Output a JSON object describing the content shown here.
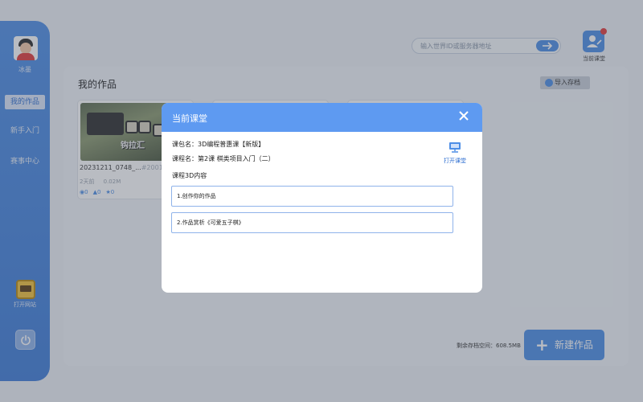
{
  "sidebar": {
    "username": "冰墨",
    "items": [
      {
        "label": "我的作品",
        "active": true
      },
      {
        "label": "新手入门",
        "active": false
      },
      {
        "label": "赛事中心",
        "active": false
      }
    ],
    "open_site_label": "打开网站"
  },
  "topbar": {
    "server_placeholder": "输入世界ID或服务器地址",
    "current_class_label": "当前课堂"
  },
  "main": {
    "title": "我的作品",
    "import_label": "导入存档",
    "works": [
      {
        "name": "20231211_0748_...",
        "id": "#2001",
        "thumb_text": "钩拉汇",
        "time": "2天前",
        "size": "0.02M",
        "views": "0",
        "likes": "0",
        "favs": "0"
      }
    ],
    "storage_text": "剩余存档空间：608.5MB",
    "new_work_label": "新建作品"
  },
  "modal": {
    "title": "当前课堂",
    "package_line": "课包名：3D编程普惠课【新版】",
    "course_line": "课程名：第2课 棋类项目入门（二）",
    "content_heading": "课程3D内容",
    "open_class_label": "打开课堂",
    "items": [
      {
        "label": "1.创作你的作品"
      },
      {
        "label": "2.作品赏析《可爱五子棋》"
      }
    ]
  },
  "colors": {
    "accent": "#4d8ee6",
    "modal_header": "#5e9af1",
    "badge": "#e23b3b"
  }
}
